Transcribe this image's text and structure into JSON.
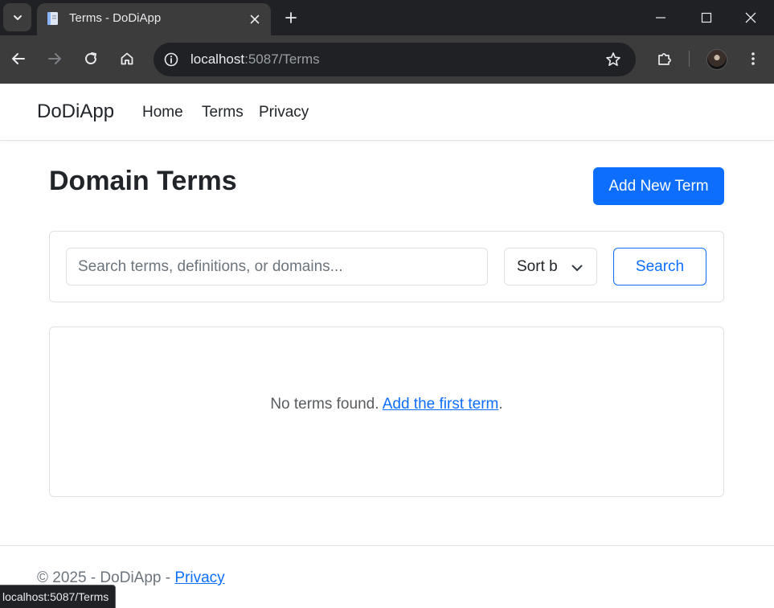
{
  "browser": {
    "tab_title": "Terms - DoDiApp",
    "url_host": "localhost",
    "url_rest": ":5087/Terms",
    "status_url": "localhost:5087/Terms"
  },
  "navbar": {
    "brand": "DoDiApp",
    "links": [
      "Home",
      "Terms",
      "Privacy"
    ]
  },
  "main": {
    "title": "Domain Terms",
    "add_button": "Add New Term",
    "search": {
      "placeholder": "Search terms, definitions, or domains...",
      "value": "",
      "sort_label": "Sort b",
      "button": "Search"
    },
    "empty": {
      "message": "No terms found.",
      "link": "Add the first term",
      "suffix": "."
    }
  },
  "footer": {
    "text": "© 2025 - DoDiApp - ",
    "link": "Privacy"
  },
  "colors": {
    "primary": "#0d6efd",
    "chrome_dark": "#202124",
    "chrome_mid": "#3c3c3c"
  }
}
